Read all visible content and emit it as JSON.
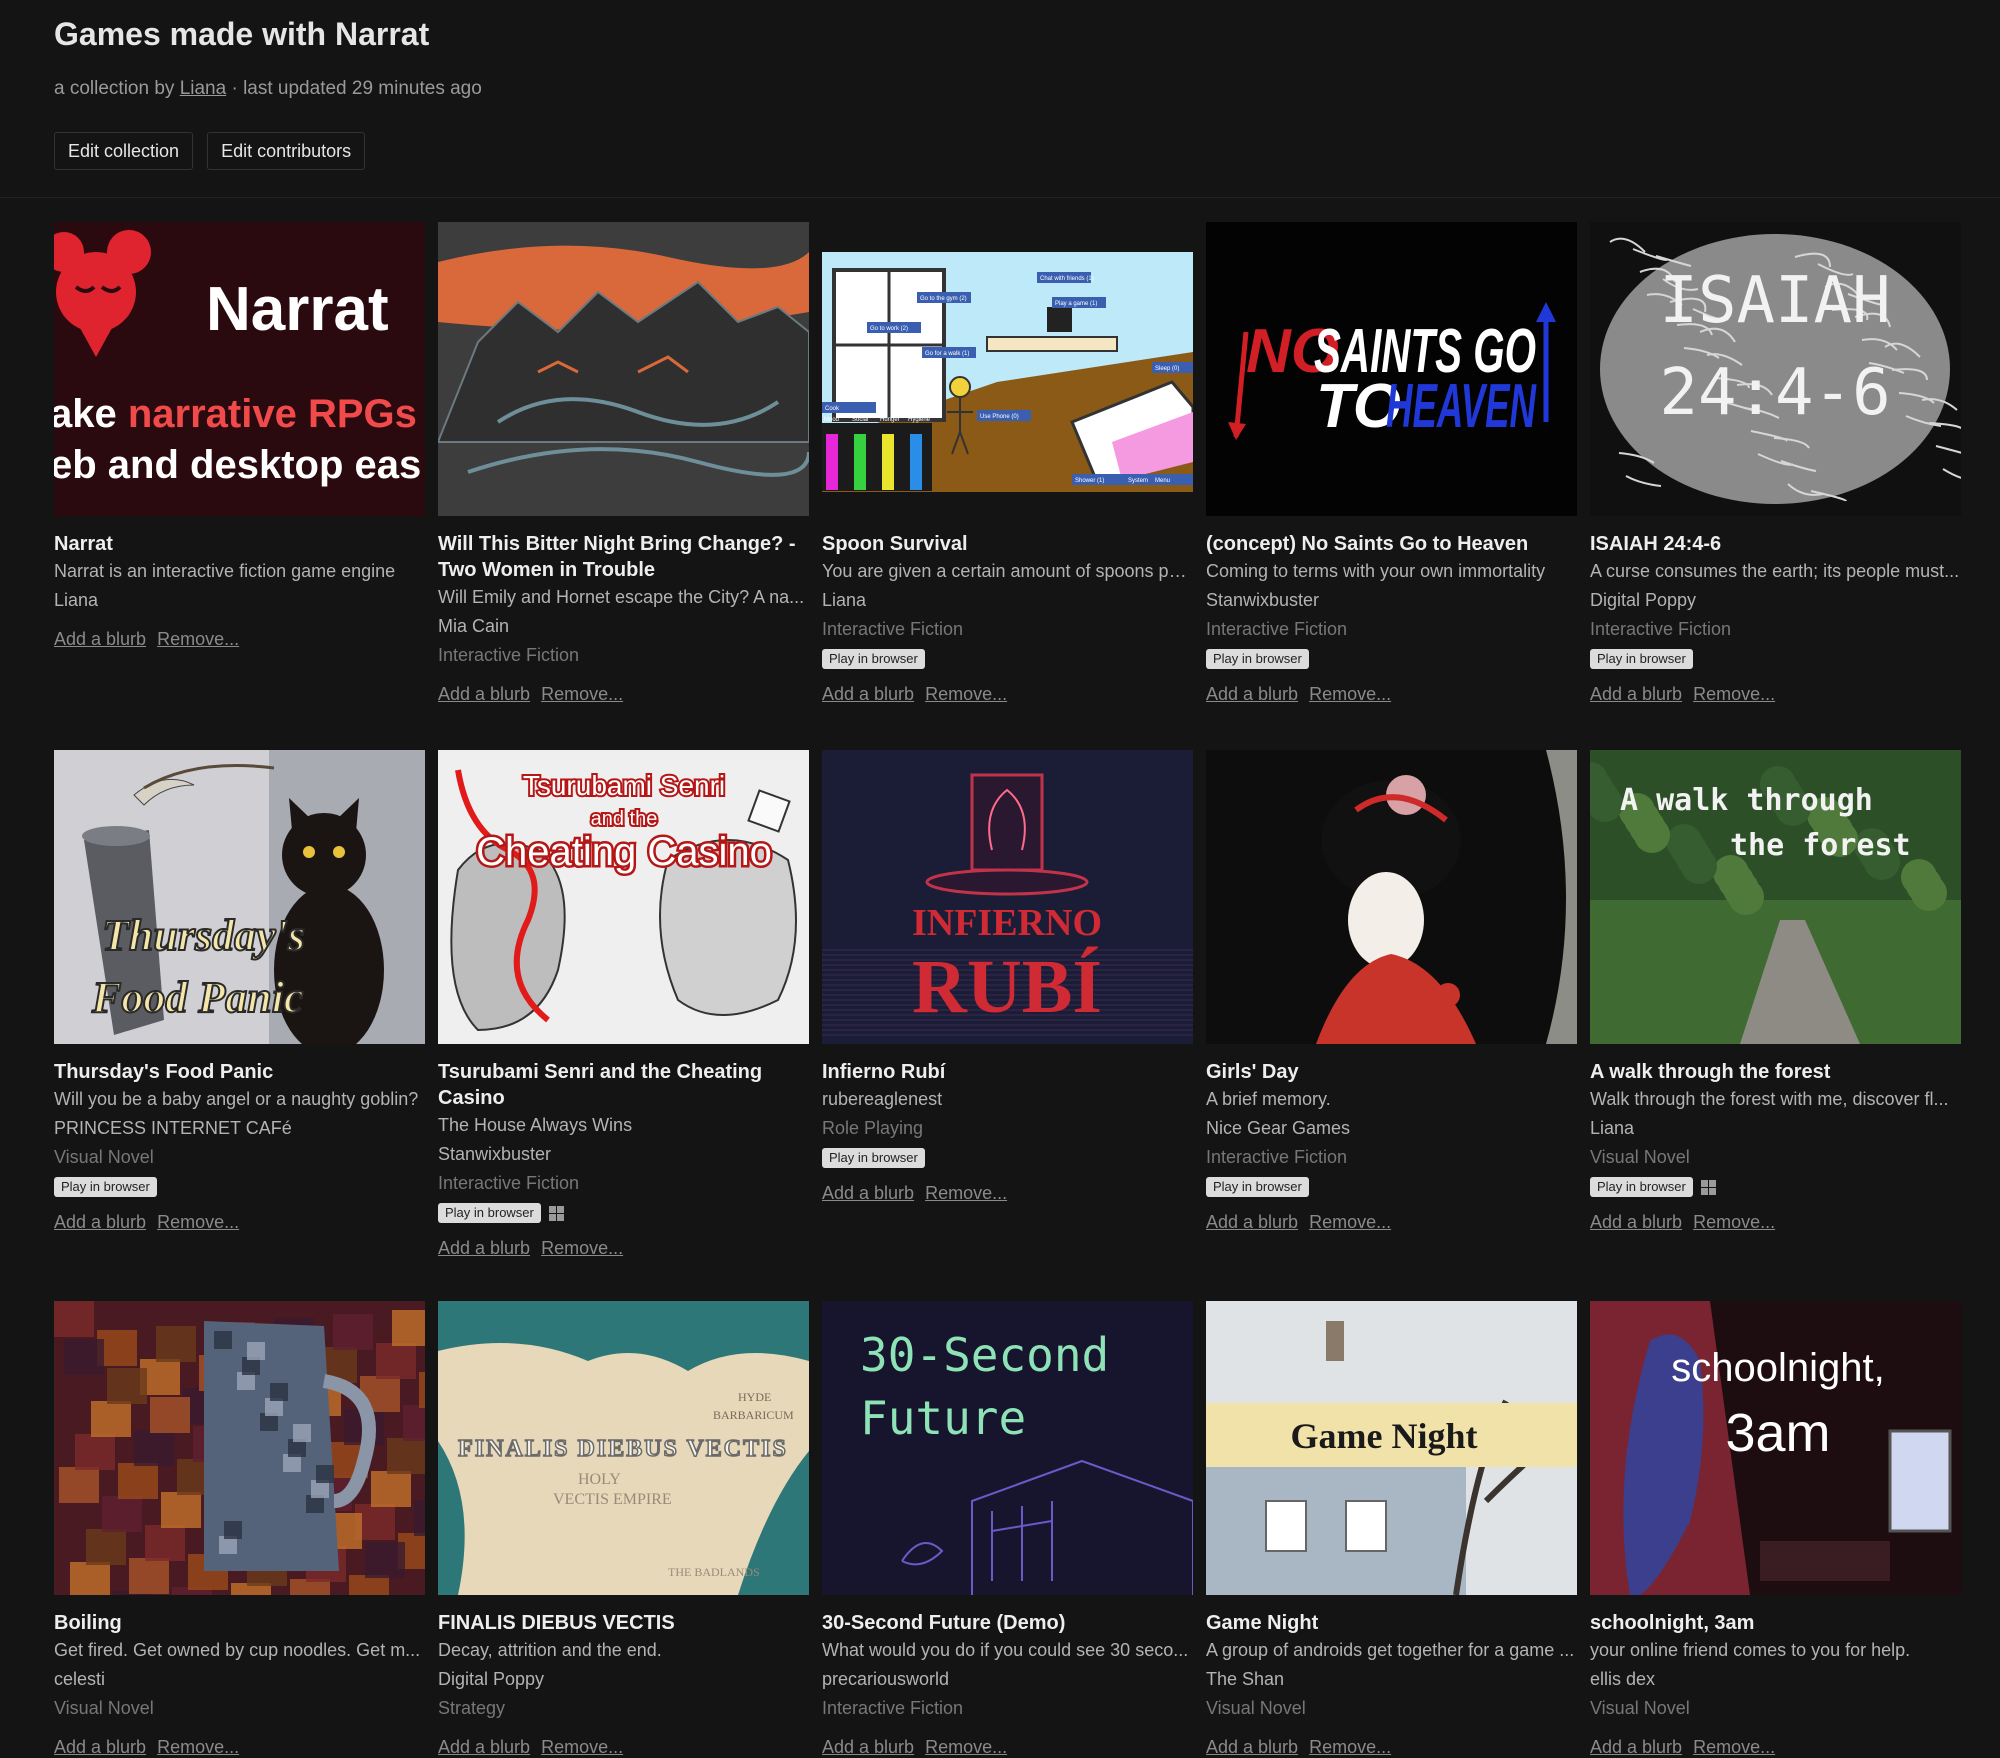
{
  "header": {
    "title": "Games made with Narrat",
    "byline_prefix": "a collection by",
    "author": "Liana",
    "byline_suffix": "· last updated 29 minutes ago",
    "edit_collection": "Edit collection",
    "edit_contributors": "Edit contributors"
  },
  "common": {
    "add_blurb": "Add a blurb",
    "remove": "Remove...",
    "play_in_browser": "Play in browser"
  },
  "games": [
    {
      "title": "Narrat",
      "desc": "Narrat is an interactive fiction game engine",
      "author": "Liana",
      "genre": "",
      "browser": false,
      "windows": false,
      "cover": {
        "line1": "Narrat",
        "line2a": "ake ",
        "line2b": "narrative RPGs",
        "line3": "eb and desktop eas"
      }
    },
    {
      "title": "Will This Bitter Night Bring Change? - Two Women in Trouble",
      "desc": "Will Emily and Hornet escape the City? A na...",
      "author": "Mia Cain",
      "genre": "Interactive Fiction",
      "browser": false,
      "windows": false
    },
    {
      "title": "Spoon Survival",
      "desc": "You are given a certain amount of spoons pe...",
      "author": "Liana",
      "genre": "Interactive Fiction",
      "browser": true,
      "windows": false
    },
    {
      "title": "(concept) No Saints Go to Heaven",
      "desc": "Coming to terms with your own immortality",
      "author": "Stanwixbuster",
      "genre": "Interactive Fiction",
      "browser": true,
      "windows": false,
      "cover": {
        "no": "NO",
        "saints_go": "SAINTS GO",
        "to": "TO",
        "heaven": "HEAVEN"
      }
    },
    {
      "title": "ISAIAH 24:4-6",
      "desc": "A curse consumes the earth; its people must...",
      "author": "Digital Poppy",
      "genre": "Interactive Fiction",
      "browser": true,
      "windows": false,
      "cover": {
        "line1": "ISAIAH",
        "line2": "24:4-6"
      }
    },
    {
      "title": "Thursday's Food Panic",
      "desc": "Will you be a baby angel or a naughty goblin?",
      "author": "PRINCESS INTERNET CAFé",
      "genre": "Visual Novel",
      "browser": true,
      "windows": false,
      "cover": {
        "line1": "Thursday's",
        "line2": "Food Panic"
      }
    },
    {
      "title": "Tsurubami Senri and the Cheating Casino",
      "desc": "The House Always Wins",
      "author": "Stanwixbuster",
      "genre": "Interactive Fiction",
      "browser": true,
      "windows": true,
      "cover": {
        "line1": "Tsurubami Senri",
        "line2": "and the",
        "line3": "Cheating Casino"
      }
    },
    {
      "title": "Infierno Rubí",
      "desc": "rubereaglenest",
      "author": "",
      "genre": "Role Playing",
      "browser": true,
      "windows": false,
      "cover": {
        "line1": "INFIERNO",
        "line2": "RUBÍ"
      }
    },
    {
      "title": "Girls' Day",
      "desc": "A brief memory.",
      "author": "Nice Gear Games",
      "genre": "Interactive Fiction",
      "browser": true,
      "windows": false
    },
    {
      "title": "A walk through the forest",
      "desc": "Walk through the forest with me, discover fl...",
      "author": "Liana",
      "genre": "Visual Novel",
      "browser": true,
      "windows": true,
      "cover": {
        "line1": "A walk through",
        "line2": "the forest"
      }
    },
    {
      "title": "Boiling",
      "desc": "Get fired. Get owned by cup noodles. Get m...",
      "author": "celesti",
      "genre": "Visual Novel",
      "browser": false,
      "windows": false
    },
    {
      "title": "FINALIS DIEBUS VECTIS",
      "desc": "Decay, attrition and the end.",
      "author": "Digital Poppy",
      "genre": "Strategy",
      "browser": false,
      "windows": false,
      "cover": {
        "line1": "FINALIS DIEBUS VECTIS",
        "line2": "HYDE",
        "line3": "BARBARICUM",
        "line4": "HOLY",
        "line5": "VECTIS EMPIRE",
        "line6": "THE BADLANDS"
      }
    },
    {
      "title": "30-Second Future (Demo)",
      "desc": "What would you do if you could see 30 seco...",
      "author": "precariousworld",
      "genre": "Interactive Fiction",
      "browser": false,
      "windows": false,
      "cover": {
        "line1": "30-Second",
        "line2": "Future"
      }
    },
    {
      "title": "Game Night",
      "desc": "A group of androids get together for a game ...",
      "author": "The Shan",
      "genre": "Visual Novel",
      "browser": false,
      "windows": false,
      "cover": {
        "line1": "Game Night"
      }
    },
    {
      "title": "schoolnight, 3am",
      "desc": "your online friend comes to you for help.",
      "author": "ellis dex",
      "genre": "Visual Novel",
      "browser": false,
      "windows": false,
      "cover": {
        "line1": "schoolnight,",
        "line2": "3am"
      }
    }
  ],
  "spoon_cover": {
    "labels": [
      "Go to the gym (2)",
      "Go to work (2)",
      "Go for a walk (1)",
      "Chat with friends (1)",
      "Play a game (1)",
      "Sleep (0)",
      "Use Phone (0)",
      "Cook",
      "Shower (1)",
      "System",
      "Menu"
    ],
    "meters": [
      "Mood",
      "Social",
      "Hunger",
      "Hygiene"
    ],
    "meter_colors": [
      "#e627d8",
      "#36d13e",
      "#e8e52c",
      "#2a8ee8"
    ]
  }
}
